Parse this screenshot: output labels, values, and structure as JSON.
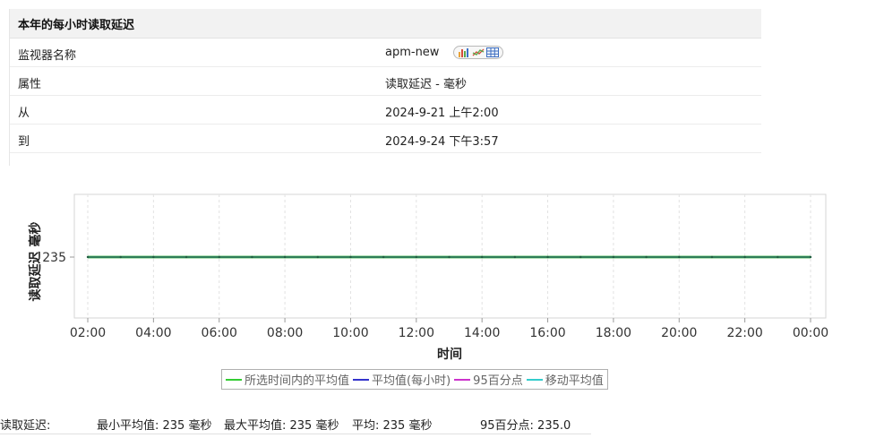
{
  "panel": {
    "title": "本年的每小时读取延迟",
    "rows": [
      {
        "label": "监视器名称",
        "value": "apm-new"
      },
      {
        "label": "属性",
        "value": "读取延迟 - 毫秒"
      },
      {
        "label": "从",
        "value": "2024-9-21 上午2:00"
      },
      {
        "label": "到",
        "value": "2024-9-24 下午3:57"
      }
    ],
    "icons": [
      "bar-chart-icon",
      "line-chart-icon",
      "table-icon"
    ]
  },
  "colors": {
    "avg_selected": "#33cc33",
    "avg_hourly": "#3333cc",
    "p95": "#cc33cc",
    "moving_avg": "#33cccc",
    "plotted_line": "#2e7d57"
  },
  "chart_data": {
    "type": "line",
    "xlabel": "时间",
    "ylabel": "读取延迟 毫秒",
    "x_ticks": [
      "02:00",
      "04:00",
      "06:00",
      "08:00",
      "10:00",
      "12:00",
      "14:00",
      "16:00",
      "18:00",
      "20:00",
      "22:00",
      "00:00"
    ],
    "y_ticks": [
      235
    ],
    "grid": true,
    "legend_position": "bottom",
    "series": [
      {
        "name": "所选时间内的平均值",
        "x": [
          "02:00",
          "00:00"
        ],
        "values": [
          235,
          235
        ]
      },
      {
        "name": "平均值(每小时)",
        "x": [
          "02:00",
          "00:00"
        ],
        "values": [
          235,
          235
        ]
      },
      {
        "name": "95百分点",
        "x": [
          "02:00",
          "00:00"
        ],
        "values": [
          235,
          235
        ]
      },
      {
        "name": "移动平均值",
        "x": [
          "02:00",
          "00:00"
        ],
        "values": [
          235,
          235
        ]
      }
    ]
  },
  "summary": {
    "label": "读取延迟:",
    "min_avg": "最小平均值:  235  毫秒",
    "max_avg": "最大平均值:  235  毫秒",
    "avg": "平均:  235  毫秒",
    "p95": "95百分点:  235.0"
  }
}
